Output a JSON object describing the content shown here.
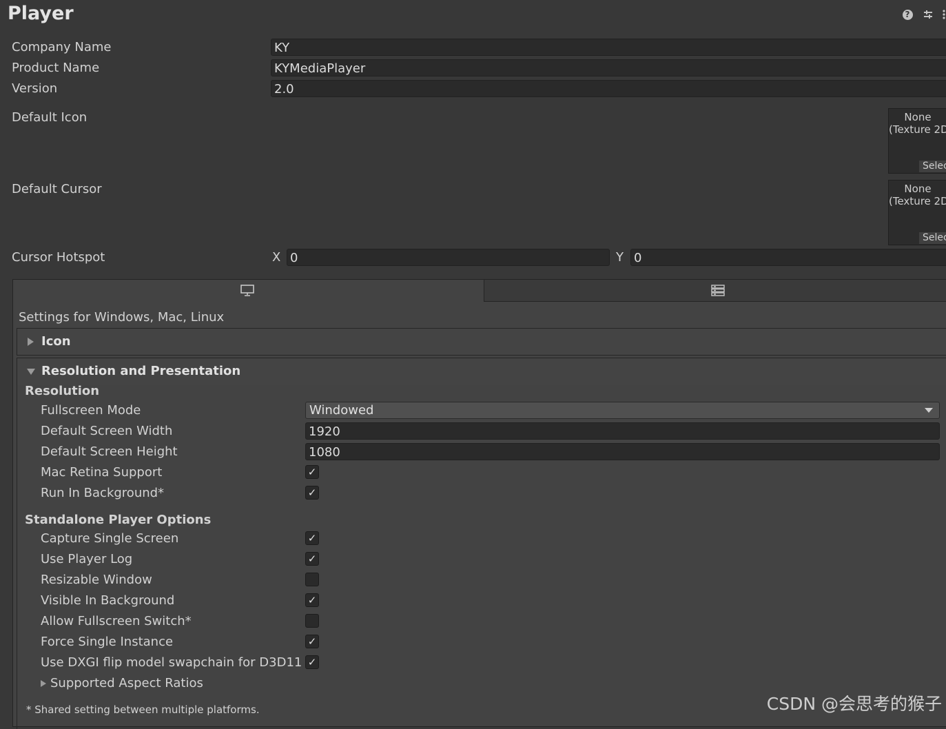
{
  "header": {
    "title": "Player",
    "icons": [
      "help-icon",
      "presets-icon",
      "more-options-icon"
    ]
  },
  "fields": {
    "company_name": {
      "label": "Company Name",
      "value": "KY"
    },
    "product_name": {
      "label": "Product Name",
      "value": "KYMediaPlayer"
    },
    "version": {
      "label": "Version",
      "value": "2.0"
    },
    "default_icon": {
      "label": "Default Icon",
      "value_line1": "None",
      "value_line2": "(Texture 2D",
      "select": "Selec"
    },
    "default_cursor": {
      "label": "Default Cursor",
      "value_line1": "None",
      "value_line2": "(Texture 2D",
      "select": "Selec"
    },
    "cursor_hotspot": {
      "label": "Cursor Hotspot",
      "x_label": "X",
      "x_value": "0",
      "y_label": "Y",
      "y_value": "0"
    }
  },
  "platform_tabs": {
    "tabs": [
      "monitor-icon",
      "server-icon"
    ],
    "active": 0,
    "settings_for": "Settings for Windows, Mac, Linux"
  },
  "sections": {
    "icon": {
      "label": "Icon",
      "expanded": false
    },
    "resolution_presentation": {
      "label": "Resolution and Presentation",
      "expanded": true
    }
  },
  "resolution": {
    "heading": "Resolution",
    "fullscreen_mode": {
      "label": "Fullscreen Mode",
      "value": "Windowed"
    },
    "default_screen_width": {
      "label": "Default Screen Width",
      "value": "1920"
    },
    "default_screen_height": {
      "label": "Default Screen Height",
      "value": "1080"
    },
    "mac_retina_support": {
      "label": "Mac Retina Support",
      "checked": true
    },
    "run_in_background": {
      "label": "Run In Background*",
      "checked": true
    }
  },
  "standalone": {
    "heading": "Standalone Player Options",
    "items": [
      {
        "label": "Capture Single Screen",
        "checked": true
      },
      {
        "label": "Use Player Log",
        "checked": true
      },
      {
        "label": "Resizable Window",
        "checked": false
      },
      {
        "label": "Visible In Background",
        "checked": true
      },
      {
        "label": "Allow Fullscreen Switch*",
        "checked": false
      },
      {
        "label": "Force Single Instance",
        "checked": true
      },
      {
        "label": "Use DXGI flip model swapchain for D3D11",
        "checked": true
      }
    ],
    "supported_aspect_ratios": "Supported Aspect Ratios"
  },
  "footnote": "* Shared setting between multiple platforms.",
  "watermark": "CSDN @会思考的猴子",
  "check_glyph": "✓"
}
